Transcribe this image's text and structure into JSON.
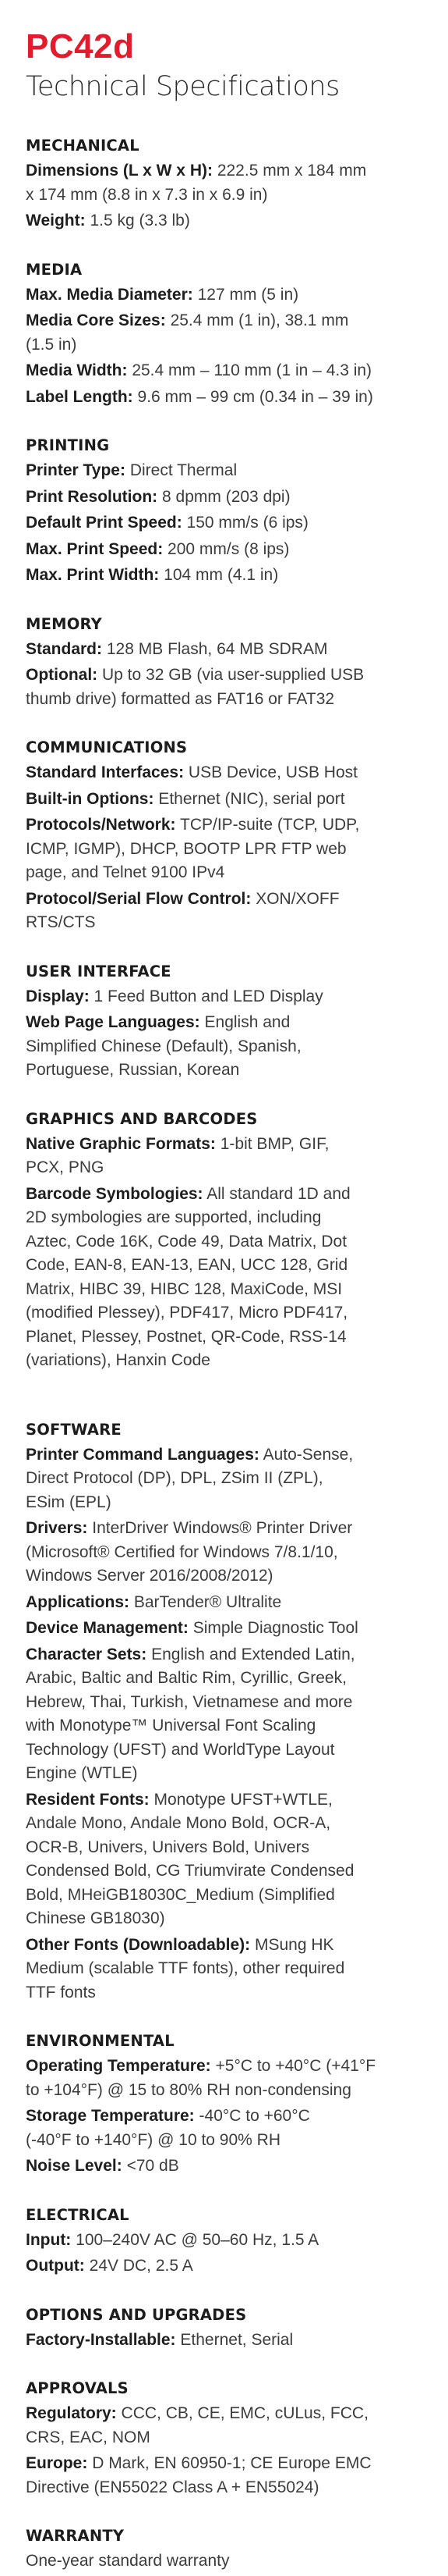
{
  "header": {
    "product": "PC42d",
    "title": "Technical Specifications"
  },
  "colors": {
    "brand_red": "#e31b2c",
    "text": "#262626"
  },
  "sections": [
    {
      "title": "MECHANICAL",
      "specs": [
        {
          "label": "Dimensions (L x W x H):",
          "value": "222.5 mm x 184 mm\nx 174 mm (8.8 in x 7.3 in x 6.9 in)"
        },
        {
          "label": "Weight:",
          "value": "1.5 kg (3.3 lb)"
        }
      ]
    },
    {
      "title": "MEDIA",
      "specs": [
        {
          "label": "Max. Media Diameter:",
          "value": "127 mm (5 in)"
        },
        {
          "label": "Media Core Sizes:",
          "value": "25.4 mm (1 in), 38.1 mm\n(1.5 in)"
        },
        {
          "label": "Media Width:",
          "value": "25.4 mm – 110 mm (1 in – 4.3 in)"
        },
        {
          "label": "Label Length:",
          "value": "9.6 mm – 99 cm (0.34 in – 39 in)"
        }
      ]
    },
    {
      "title": "PRINTING",
      "specs": [
        {
          "label": "Printer Type:",
          "value": "Direct Thermal"
        },
        {
          "label": "Print Resolution:",
          "value": "8 dpmm (203 dpi)"
        },
        {
          "label": "Default Print Speed:",
          "value": "150 mm/s (6 ips)"
        },
        {
          "label": "Max. Print Speed:",
          "value": "200 mm/s (8 ips)"
        },
        {
          "label": "Max. Print Width:",
          "value": "104 mm (4.1 in)"
        }
      ]
    },
    {
      "title": "MEMORY",
      "specs": [
        {
          "label": "Standard:",
          "value": "128 MB Flash, 64 MB SDRAM"
        },
        {
          "label": "Optional:",
          "value": "Up to 32 GB (via user-supplied USB\nthumb drive) formatted as FAT16 or FAT32"
        }
      ]
    },
    {
      "title": "COMMUNICATIONS",
      "specs": [
        {
          "label": "Standard Interfaces:",
          "value": "USB Device, USB Host"
        },
        {
          "label": "Built-in Options:",
          "value": "Ethernet (NIC), serial port"
        },
        {
          "label": "Protocols/Network:",
          "value": "TCP/IP-suite (TCP, UDP,\nICMP, IGMP), DHCP, BOOTP LPR FTP web\npage, and Telnet 9100 IPv4"
        },
        {
          "label": "Protocol/Serial Flow Control:",
          "value": "XON/XOFF\nRTS/CTS"
        }
      ]
    },
    {
      "title": "USER INTERFACE",
      "specs": [
        {
          "label": "Display:",
          "value": "1 Feed Button and LED Display"
        },
        {
          "label": "Web Page Languages:",
          "value": "English and\nSimplified Chinese (Default), Spanish,\nPortuguese, Russian, Korean"
        }
      ]
    },
    {
      "title": "GRAPHICS AND BARCODES",
      "specs": [
        {
          "label": "Native Graphic Formats:",
          "value": "1-bit BMP, GIF,\nPCX, PNG"
        },
        {
          "label": "Barcode Symbologies:",
          "value": "All standard 1D and\n2D symbologies are supported, including\nAztec, Code 16K, Code 49, Data Matrix, Dot\nCode, EAN-8, EAN-13, EAN, UCC 128, Grid\nMatrix, HIBC 39, HIBC 128, MaxiCode, MSI\n(modified Plessey), PDF417, Micro PDF417,\nPlanet, Plessey, Postnet, QR-Code, RSS-14\n(variations), Hanxin Code"
        }
      ]
    },
    {
      "title": "SOFTWARE",
      "specs": [
        {
          "label": "Printer Command Languages:",
          "value": "Auto-Sense,\nDirect Protocol (DP), DPL, ZSim II (ZPL),\nESim (EPL)"
        },
        {
          "label": "Drivers:",
          "value": "InterDriver Windows® Printer Driver\n(Microsoft® Certified for Windows 7/8.1/10,\nWindows Server 2016/2008/2012)"
        },
        {
          "label": "Applications:",
          "value": "BarTender® Ultralite"
        },
        {
          "label": "Device Management:",
          "value": "Simple Diagnostic Tool"
        },
        {
          "label": "Character Sets:",
          "value": "English and Extended Latin,\nArabic, Baltic and Baltic Rim, Cyrillic, Greek,\nHebrew, Thai, Turkish, Vietnamese and more\nwith Monotype™ Universal Font Scaling\nTechnology (UFST) and WorldType Layout\nEngine (WTLE)"
        },
        {
          "label": "Resident Fonts:",
          "value": "Monotype UFST+WTLE,\nAndale Mono, Andale Mono Bold, OCR-A,\nOCR-B, Univers, Univers Bold, Univers\nCondensed Bold, CG Triumvirate Condensed\nBold, MHeiGB18030C_Medium (Simplified\nChinese GB18030)"
        },
        {
          "label": "Other Fonts (Downloadable):",
          "value": "MSung HK\nMedium (scalable TTF fonts), other required\nTTF fonts"
        }
      ]
    },
    {
      "title": "ENVIRONMENTAL",
      "specs": [
        {
          "label": "Operating Temperature:",
          "value": "+5°C to +40°C (+41°F\nto +104°F) @ 15 to 80% RH non-condensing"
        },
        {
          "label": "Storage Temperature:",
          "value": "-40°C to +60°C\n(-40°F to +140°F) @ 10 to 90% RH"
        },
        {
          "label": "Noise Level:",
          "value": "<70 dB"
        }
      ]
    },
    {
      "title": "ELECTRICAL",
      "specs": [
        {
          "label": "Input:",
          "value": "100–240V AC @ 50–60 Hz, 1.5 A"
        },
        {
          "label": "Output:",
          "value": "24V DC, 2.5 A"
        }
      ]
    },
    {
      "title": "OPTIONS AND UPGRADES",
      "specs": [
        {
          "label": "Factory-Installable:",
          "value": "Ethernet, Serial"
        }
      ]
    },
    {
      "title": "APPROVALS",
      "specs": [
        {
          "label": "Regulatory:",
          "value": "CCC, CB, CE, EMC, cULus, FCC,\nCRS, EAC, NOM"
        },
        {
          "label": "Europe:",
          "value": "D Mark, EN 60950-1; CE Europe EMC\nDirective (EN55022 Class A + EN55024)"
        }
      ]
    },
    {
      "title": "WARRANTY",
      "specs": [
        {
          "label": "",
          "value": "One-year standard warranty"
        }
      ]
    }
  ]
}
